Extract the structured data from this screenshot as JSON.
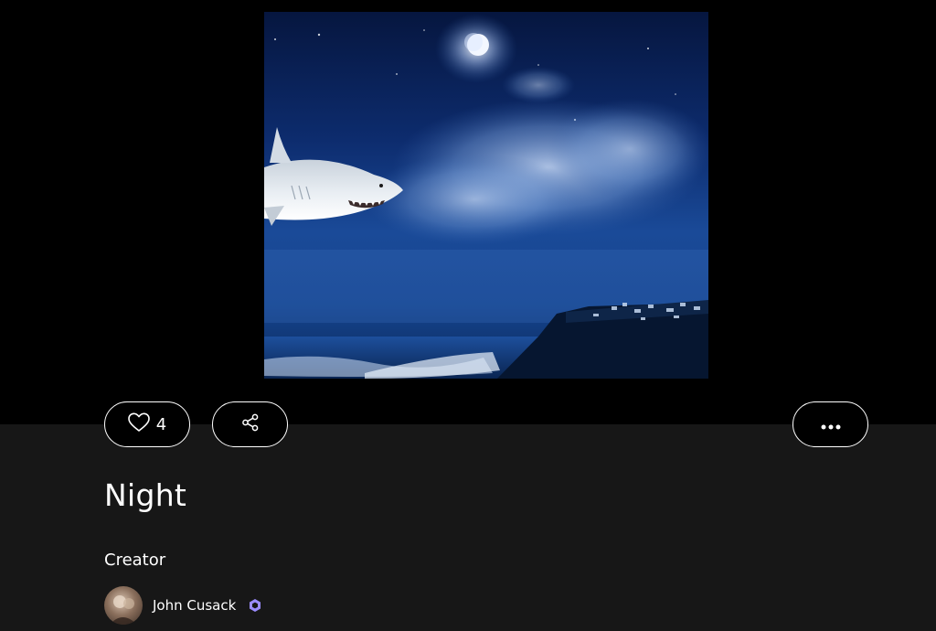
{
  "artwork": {
    "image_description_icon": "shark-moon-night-sky-artwork"
  },
  "actions": {
    "like_icon": "heart-icon",
    "like_count": "4",
    "share_icon": "share-icon",
    "more_icon": "more-dots-icon"
  },
  "post": {
    "title": "Night",
    "creator_label": "Creator"
  },
  "creator": {
    "name": "John Cusack",
    "badge_icon": "verified-badge-icon",
    "badge_color": "#9b8cff"
  },
  "colors": {
    "page_bg": "#171717",
    "hero_bg": "#000000",
    "text": "#ffffff"
  }
}
